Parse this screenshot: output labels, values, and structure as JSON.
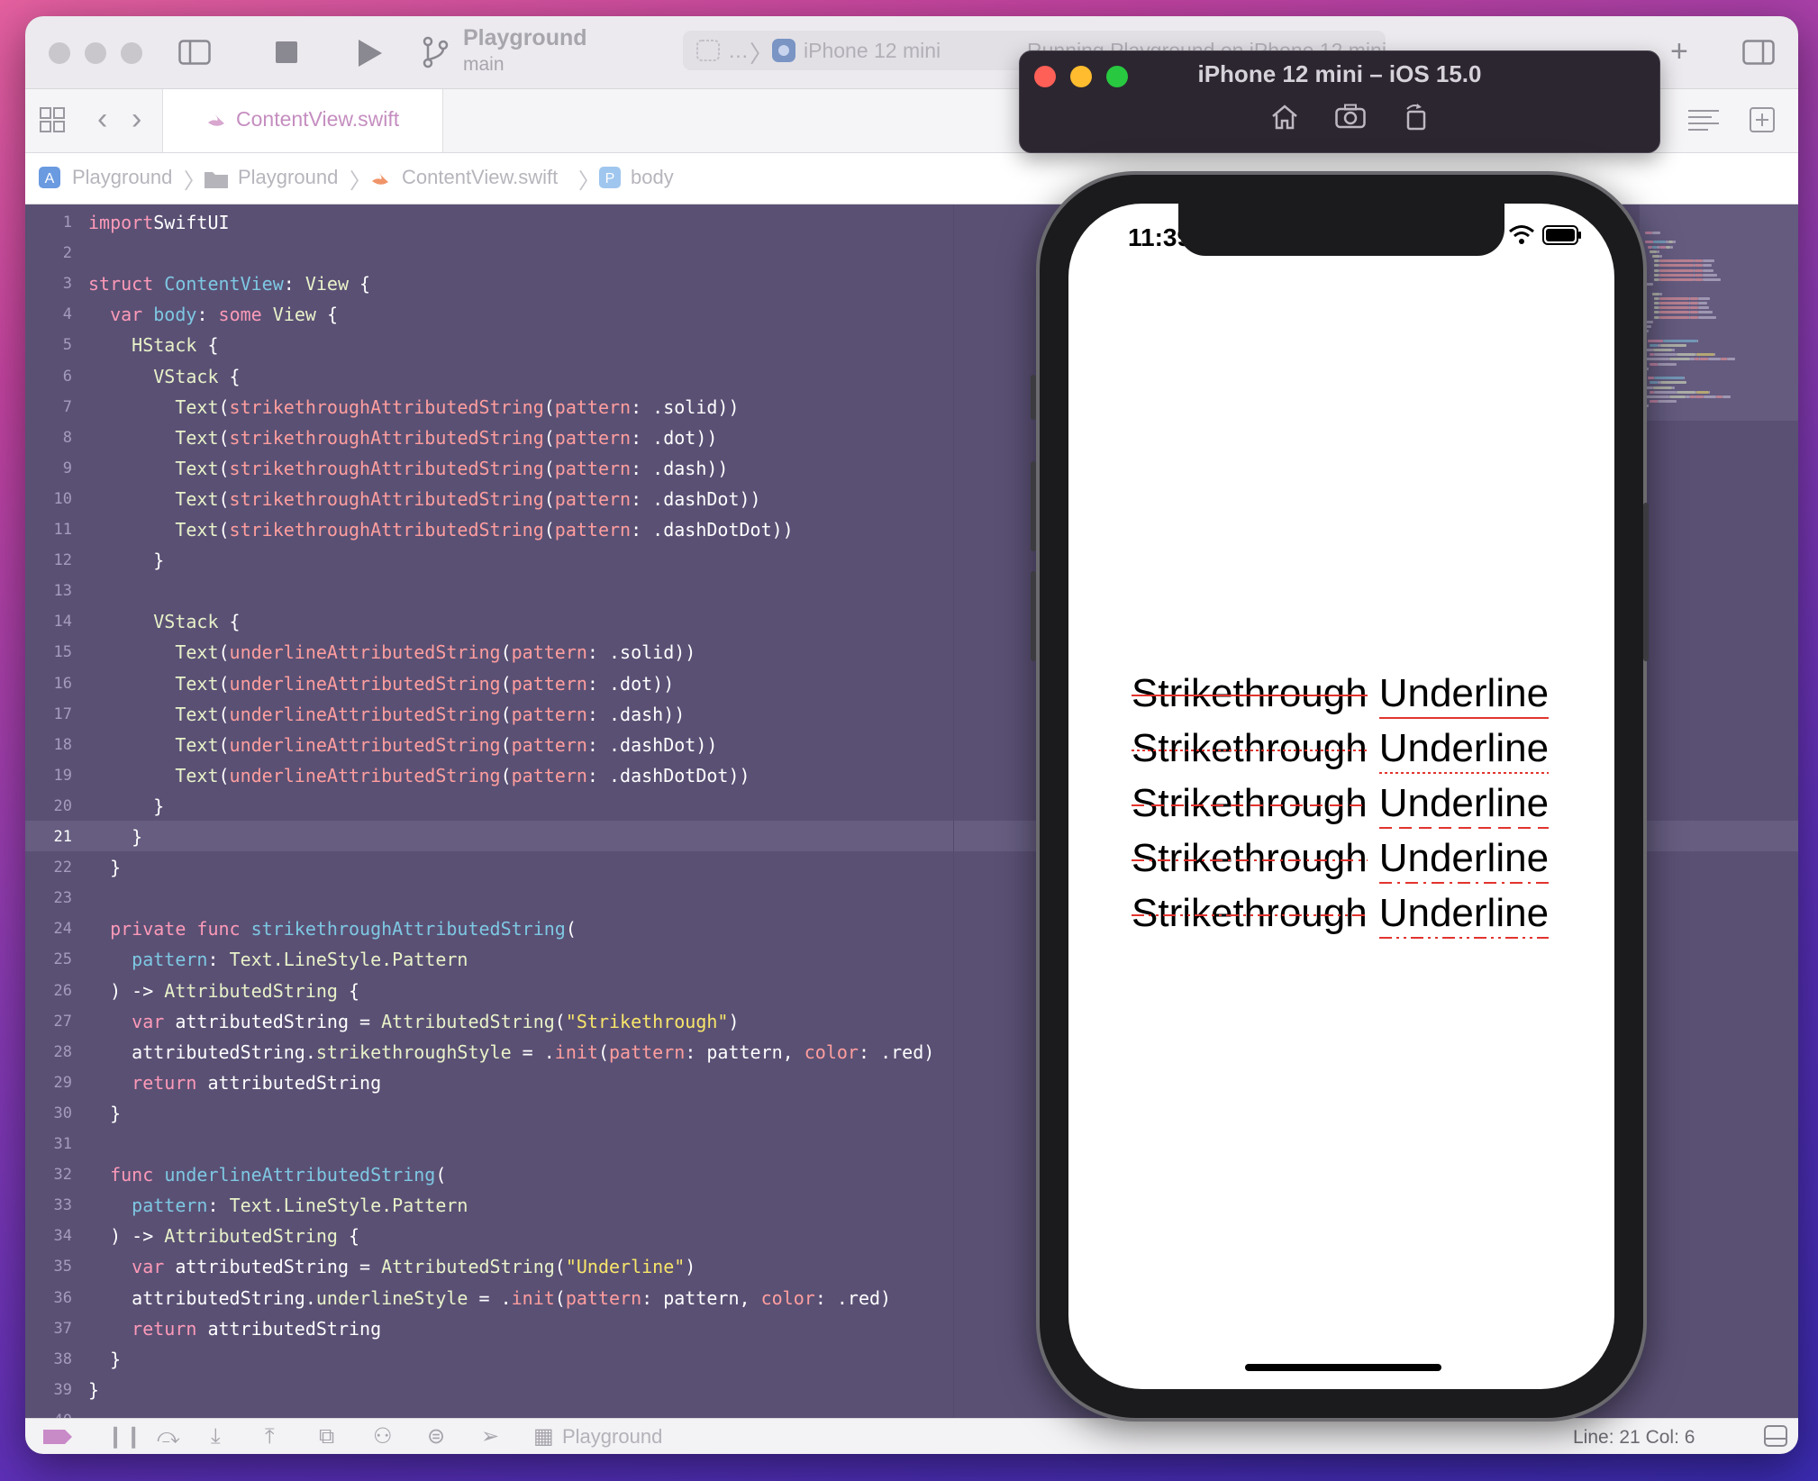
{
  "titlebar": {
    "project": "Playground",
    "branch": "main",
    "scheme_dots": "…",
    "scheme_device": "iPhone 12 mini",
    "activity": "Running Playground on iPhone 12 mini"
  },
  "tab": {
    "label": "ContentView.swift"
  },
  "breadcrumb": [
    "Playground",
    "Playground",
    "ContentView.swift",
    "body"
  ],
  "editor": {
    "current_line": 21,
    "lines": [
      [
        [
          "kw",
          "import"
        ],
        [
          "",
          "SwiftUI"
        ]
      ],
      [],
      [
        [
          "kw",
          "struct "
        ],
        [
          "fn",
          "ContentView"
        ],
        [
          "",
          ": "
        ],
        [
          "ty",
          "View"
        ],
        [
          "",
          " {"
        ]
      ],
      [
        [
          "",
          "  "
        ],
        [
          "kw",
          "var "
        ],
        [
          "fn",
          "body"
        ],
        [
          "",
          ": "
        ],
        [
          "kw",
          "some "
        ],
        [
          "ty",
          "View"
        ],
        [
          "",
          " {"
        ]
      ],
      [
        [
          "",
          "    "
        ],
        [
          "ty",
          "HStack"
        ],
        [
          "",
          " {"
        ]
      ],
      [
        [
          "",
          "      "
        ],
        [
          "ty",
          "VStack"
        ],
        [
          "",
          " {"
        ]
      ],
      [
        [
          "",
          "        "
        ],
        [
          "ty",
          "Text"
        ],
        [
          "",
          "("
        ],
        [
          "pm",
          "strikethroughAttributedString"
        ],
        [
          "",
          "("
        ],
        [
          "pm",
          "pattern"
        ],
        [
          "",
          ": .solid))"
        ]
      ],
      [
        [
          "",
          "        "
        ],
        [
          "ty",
          "Text"
        ],
        [
          "",
          "("
        ],
        [
          "pm",
          "strikethroughAttributedString"
        ],
        [
          "",
          "("
        ],
        [
          "pm",
          "pattern"
        ],
        [
          "",
          ": .dot))"
        ]
      ],
      [
        [
          "",
          "        "
        ],
        [
          "ty",
          "Text"
        ],
        [
          "",
          "("
        ],
        [
          "pm",
          "strikethroughAttributedString"
        ],
        [
          "",
          "("
        ],
        [
          "pm",
          "pattern"
        ],
        [
          "",
          ": .dash))"
        ]
      ],
      [
        [
          "",
          "        "
        ],
        [
          "ty",
          "Text"
        ],
        [
          "",
          "("
        ],
        [
          "pm",
          "strikethroughAttributedString"
        ],
        [
          "",
          "("
        ],
        [
          "pm",
          "pattern"
        ],
        [
          "",
          ": .dashDot))"
        ]
      ],
      [
        [
          "",
          "        "
        ],
        [
          "ty",
          "Text"
        ],
        [
          "",
          "("
        ],
        [
          "pm",
          "strikethroughAttributedString"
        ],
        [
          "",
          "("
        ],
        [
          "pm",
          "pattern"
        ],
        [
          "",
          ": .dashDotDot))"
        ]
      ],
      [
        [
          "",
          "      }"
        ]
      ],
      [],
      [
        [
          "",
          "      "
        ],
        [
          "ty",
          "VStack"
        ],
        [
          "",
          " {"
        ]
      ],
      [
        [
          "",
          "        "
        ],
        [
          "ty",
          "Text"
        ],
        [
          "",
          "("
        ],
        [
          "pm",
          "underlineAttributedString"
        ],
        [
          "",
          "("
        ],
        [
          "pm",
          "pattern"
        ],
        [
          "",
          ": .solid))"
        ]
      ],
      [
        [
          "",
          "        "
        ],
        [
          "ty",
          "Text"
        ],
        [
          "",
          "("
        ],
        [
          "pm",
          "underlineAttributedString"
        ],
        [
          "",
          "("
        ],
        [
          "pm",
          "pattern"
        ],
        [
          "",
          ": .dot))"
        ]
      ],
      [
        [
          "",
          "        "
        ],
        [
          "ty",
          "Text"
        ],
        [
          "",
          "("
        ],
        [
          "pm",
          "underlineAttributedString"
        ],
        [
          "",
          "("
        ],
        [
          "pm",
          "pattern"
        ],
        [
          "",
          ": .dash))"
        ]
      ],
      [
        [
          "",
          "        "
        ],
        [
          "ty",
          "Text"
        ],
        [
          "",
          "("
        ],
        [
          "pm",
          "underlineAttributedString"
        ],
        [
          "",
          "("
        ],
        [
          "pm",
          "pattern"
        ],
        [
          "",
          ": .dashDot))"
        ]
      ],
      [
        [
          "",
          "        "
        ],
        [
          "ty",
          "Text"
        ],
        [
          "",
          "("
        ],
        [
          "pm",
          "underlineAttributedString"
        ],
        [
          "",
          "("
        ],
        [
          "pm",
          "pattern"
        ],
        [
          "",
          ": .dashDotDot))"
        ]
      ],
      [
        [
          "",
          "      }"
        ]
      ],
      [
        [
          "",
          "    }"
        ]
      ],
      [
        [
          "",
          "  }"
        ]
      ],
      [],
      [
        [
          "",
          "  "
        ],
        [
          "kw",
          "private func "
        ],
        [
          "fn",
          "strikethroughAttributedString"
        ],
        [
          "",
          "("
        ]
      ],
      [
        [
          "",
          "    "
        ],
        [
          "fn",
          "pattern"
        ],
        [
          "",
          ": "
        ],
        [
          "ty",
          "Text.LineStyle.Pattern"
        ]
      ],
      [
        [
          "",
          "  ) -> "
        ],
        [
          "ty",
          "AttributedString"
        ],
        [
          "",
          " {"
        ]
      ],
      [
        [
          "",
          "    "
        ],
        [
          "kw",
          "var "
        ],
        [
          "",
          "attributedString = "
        ],
        [
          "ty",
          "AttributedString"
        ],
        [
          "",
          "("
        ],
        [
          "st",
          "\"Strikethrough\""
        ],
        [
          "",
          ")"
        ]
      ],
      [
        [
          "",
          "    attributedString."
        ],
        [
          "ty",
          "strikethroughStyle"
        ],
        [
          "",
          " = ."
        ],
        [
          "pm",
          "init"
        ],
        [
          "",
          "("
        ],
        [
          "pm",
          "pattern"
        ],
        [
          "",
          ": pattern, "
        ],
        [
          "pm",
          "color"
        ],
        [
          "",
          ": .red)"
        ]
      ],
      [
        [
          "",
          "    "
        ],
        [
          "kw",
          "return "
        ],
        [
          "",
          "attributedString"
        ]
      ],
      [
        [
          "",
          "  }"
        ]
      ],
      [],
      [
        [
          "",
          "  "
        ],
        [
          "kw",
          "func "
        ],
        [
          "fn",
          "underlineAttributedString"
        ],
        [
          "",
          "("
        ]
      ],
      [
        [
          "",
          "    "
        ],
        [
          "fn",
          "pattern"
        ],
        [
          "",
          ": "
        ],
        [
          "ty",
          "Text.LineStyle.Pattern"
        ]
      ],
      [
        [
          "",
          "  ) -> "
        ],
        [
          "ty",
          "AttributedString"
        ],
        [
          "",
          " {"
        ]
      ],
      [
        [
          "",
          "    "
        ],
        [
          "kw",
          "var "
        ],
        [
          "",
          "attributedString = "
        ],
        [
          "ty",
          "AttributedString"
        ],
        [
          "",
          "("
        ],
        [
          "st",
          "\"Underline\""
        ],
        [
          "",
          ")"
        ]
      ],
      [
        [
          "",
          "    attributedString."
        ],
        [
          "ty",
          "underlineStyle"
        ],
        [
          "",
          " = ."
        ],
        [
          "pm",
          "init"
        ],
        [
          "",
          "("
        ],
        [
          "pm",
          "pattern"
        ],
        [
          "",
          ": pattern, "
        ],
        [
          "pm",
          "color"
        ],
        [
          "",
          ": .red)"
        ]
      ],
      [
        [
          "",
          "    "
        ],
        [
          "kw",
          "return "
        ],
        [
          "",
          "attributedString"
        ]
      ],
      [
        [
          "",
          "  }"
        ]
      ],
      [
        [
          "",
          "}"
        ]
      ],
      []
    ]
  },
  "simulator": {
    "title": "iPhone 12 mini – iOS 15.0",
    "time": "11:39",
    "rows": [
      {
        "strike": "Strikethrough",
        "under": "Underline",
        "pattern": "solid"
      },
      {
        "strike": "Strikethrough",
        "under": "Underline",
        "pattern": "dot"
      },
      {
        "strike": "Strikethrough",
        "under": "Underline",
        "pattern": "dash"
      },
      {
        "strike": "Strikethrough",
        "under": "Underline",
        "pattern": "dashDot"
      },
      {
        "strike": "Strikethrough",
        "under": "Underline",
        "pattern": "dashDotDot"
      }
    ],
    "line_color": "#e2342e"
  },
  "statusbar": {
    "target": "Playground",
    "position": "Line: 21  Col: 6"
  },
  "colors": {
    "editor_bg": "#5a5074",
    "keyword": "#fc9ab8",
    "type": "#e8f2c9",
    "declaration": "#7ec8e3",
    "parameter": "#ff9e9e",
    "string": "#f8e66a"
  }
}
